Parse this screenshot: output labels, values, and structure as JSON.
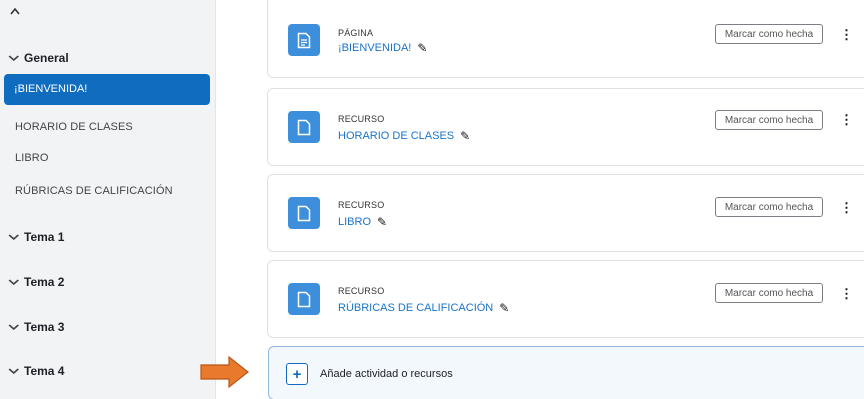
{
  "sidebar": {
    "top_icon": "chevron-up-icon",
    "sections": [
      {
        "label": "General",
        "icon": "chevron-down-icon"
      },
      {
        "label": "Tema 1",
        "icon": "chevron-down-icon"
      },
      {
        "label": "Tema 2",
        "icon": "chevron-down-icon"
      },
      {
        "label": "Tema 3",
        "icon": "chevron-down-icon"
      },
      {
        "label": "Tema 4",
        "icon": "chevron-down-icon"
      }
    ],
    "items": [
      {
        "label": "¡BIENVENIDA!",
        "active": true
      },
      {
        "label": "HORARIO DE CLASES",
        "active": false
      },
      {
        "label": "LIBRO",
        "active": false
      },
      {
        "label": "RÚBRICAS DE CALIFICACIÓN",
        "active": false
      }
    ],
    "active_color": "#0f6cbf"
  },
  "activities": [
    {
      "type": "PÁGINA",
      "name": "¡BIENVENIDA!",
      "icon": "page-icon",
      "button": "Marcar como hecha"
    },
    {
      "type": "RECURSO",
      "name": "HORARIO DE CLASES",
      "icon": "file-icon",
      "button": "Marcar como hecha"
    },
    {
      "type": "RECURSO",
      "name": "LIBRO",
      "icon": "file-icon",
      "button": "Marcar como hecha"
    },
    {
      "type": "RECURSO",
      "name": "RÚBRICAS DE CALIFICACIÓN",
      "icon": "file-icon",
      "button": "Marcar como hecha"
    }
  ],
  "add_activity": {
    "label": "Añade actividad o recursos",
    "icon": "plus-icon"
  },
  "annotation": {
    "icon": "orange-arrow-icon",
    "color": "#e9792c"
  }
}
